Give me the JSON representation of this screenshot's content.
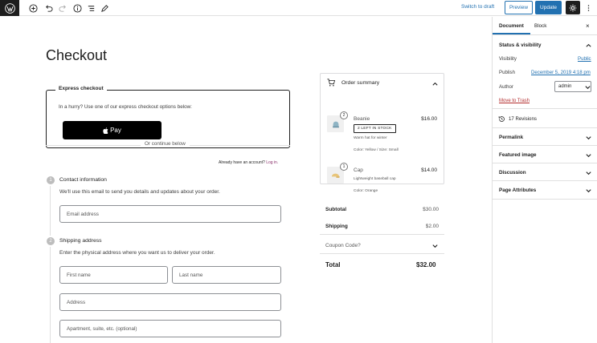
{
  "toolbar": {
    "switch_to_draft": "Switch to draft",
    "preview": "Preview",
    "update": "Update",
    "icons": [
      "wordpress-icon",
      "add-block-icon",
      "undo-icon",
      "redo-icon",
      "info-icon",
      "list-view-icon",
      "edit-icon",
      "settings-icon",
      "more-icon"
    ]
  },
  "editor": {
    "title": "Checkout",
    "express": {
      "legend": "Express checkout",
      "text": "In a hurry? Use one of our express checkout options below:",
      "pay_label": "Pay"
    },
    "or_continue": "Or continue below",
    "contact": {
      "number": "1",
      "title": "Contact information",
      "account_text": "Already have an account?",
      "login_link": "Log in.",
      "description": "We'll use this email to send you details and updates about your order.",
      "email_placeholder": "Email address"
    },
    "shipping": {
      "number": "2",
      "title": "Shipping address",
      "description": "Enter the physical address where you want us to deliver your order.",
      "first_name": "First name",
      "last_name": "Last name",
      "address": "Address",
      "apartment": "Apartment, suite, etc. (optional)"
    }
  },
  "summary": {
    "title": "Order summary",
    "items": [
      {
        "qty": "2",
        "name": "Beanie",
        "price": "$16.00",
        "badge": "2 LEFT IN STOCK",
        "desc": "Warm hat for winter",
        "attrs": "Color: Yellow / Size: Small"
      },
      {
        "qty": "1",
        "name": "Cap",
        "price": "$14.00",
        "desc": "Lightweight baseball cap",
        "attrs": "Color: Orange"
      }
    ],
    "subtotal_label": "Subtotal",
    "subtotal": "$30.00",
    "shipping_label": "Shipping",
    "shipping": "$2.00",
    "coupon": "Coupon Code?",
    "total_label": "Total",
    "total": "$32.00"
  },
  "sidebar": {
    "tabs": [
      "Document",
      "Block"
    ],
    "close": "×",
    "status_title": "Status & visibility",
    "visibility_label": "Visibility",
    "visibility_value": "Public",
    "publish_label": "Publish",
    "publish_value": "December 5, 2019 4:18 pm",
    "author_label": "Author",
    "author_value": "admin",
    "trash": "Move to Trash",
    "revisions": "17 Revisions",
    "panels": [
      "Permalink",
      "Featured image",
      "Discussion",
      "Page Attributes"
    ]
  },
  "colors": {
    "accent": "#2271b1",
    "dark": "#1e1e1e",
    "trash": "#b32d2e",
    "login_link": "#8a2f6b"
  }
}
